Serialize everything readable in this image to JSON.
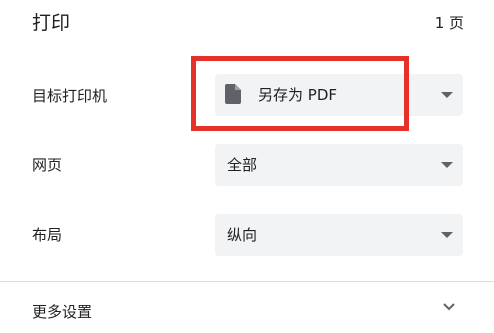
{
  "header": {
    "title": "打印",
    "page_count": "1 页"
  },
  "settings": {
    "destination": {
      "label": "目标打印机",
      "value": "另存为 PDF",
      "icon": "document-icon"
    },
    "pages": {
      "label": "网页",
      "value": "全部"
    },
    "layout": {
      "label": "布局",
      "value": "纵向"
    }
  },
  "more_settings": {
    "label": "更多设置"
  },
  "colors": {
    "highlight": "#e53128",
    "select_bg": "#f1f3f4",
    "icon": "#5f6368"
  }
}
